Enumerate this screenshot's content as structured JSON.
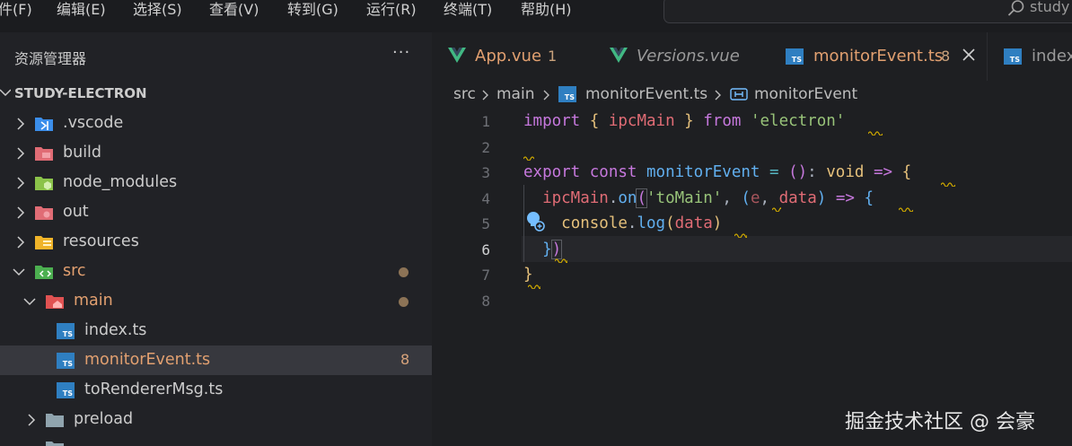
{
  "menu": [
    "件(F)",
    "编辑(E)",
    "选择(S)",
    "查看(V)",
    "转到(G)",
    "运行(R)",
    "终端(T)",
    "帮助(H)"
  ],
  "search": {
    "text": "study"
  },
  "sidebar": {
    "title": "资源管理器",
    "more": "···",
    "project": "STUDY-ELECTRON",
    "items": [
      {
        "label": ".vscode",
        "badge": ""
      },
      {
        "label": "build",
        "badge": ""
      },
      {
        "label": "node_modules",
        "badge": ""
      },
      {
        "label": "out",
        "badge": ""
      },
      {
        "label": "resources",
        "badge": ""
      },
      {
        "label": "src",
        "badge": ""
      },
      {
        "label": "main",
        "badge": ""
      },
      {
        "label": "index.ts",
        "badge": ""
      },
      {
        "label": "monitorEvent.ts",
        "badge": "8"
      },
      {
        "label": "toRendererMsg.ts",
        "badge": ""
      },
      {
        "label": "preload",
        "badge": ""
      }
    ]
  },
  "tabs": [
    {
      "label": "App.vue",
      "count": "1",
      "icon": "vue-icon"
    },
    {
      "label": "Versions.vue",
      "count": "",
      "icon": "vue-icon"
    },
    {
      "label": "monitorEvent.ts",
      "count": "8",
      "icon": "ts-icon"
    },
    {
      "label": "index",
      "count": "",
      "icon": "ts-icon"
    }
  ],
  "breadcrumb": {
    "src": "src",
    "main": "main",
    "file": "monitorEvent.ts",
    "symbol": "monitorEvent",
    "ts_badge": "TS"
  },
  "editor": {
    "line_numbers": [
      "1",
      "2",
      "3",
      "4",
      "5",
      "6",
      "7",
      "8"
    ],
    "current_line": "6",
    "code": {
      "l1": {
        "import": "import",
        "ob": "{",
        "ipcMain": "ipcMain",
        "cb": "}",
        "from": "from",
        "str": "'electron'"
      },
      "l3": {
        "export": "export",
        "const": "const",
        "name": "monitorEvent",
        "eq": "=",
        "paren": "()",
        "colon": ":",
        "void": "void",
        "arrow": "=>",
        "brace": "{"
      },
      "l4": {
        "obj": "ipcMain",
        "dot": ".",
        "on": "on",
        "op": "(",
        "str": "'toMain'",
        "comma": ",",
        "pp": "(",
        "e": "e",
        "comma2": ",",
        "data": "data",
        "cp": ")",
        "arrow": "=>",
        "brace": "{"
      },
      "l5": {
        "console": "console",
        "dot": ".",
        "log": "log",
        "op": "(",
        "data": "data",
        "cp": ")"
      },
      "l6": {
        "brace": "}",
        "paren": ")"
      },
      "l7": {
        "brace": "}"
      }
    }
  },
  "watermark": "掘金技术社区 @ 会豪"
}
